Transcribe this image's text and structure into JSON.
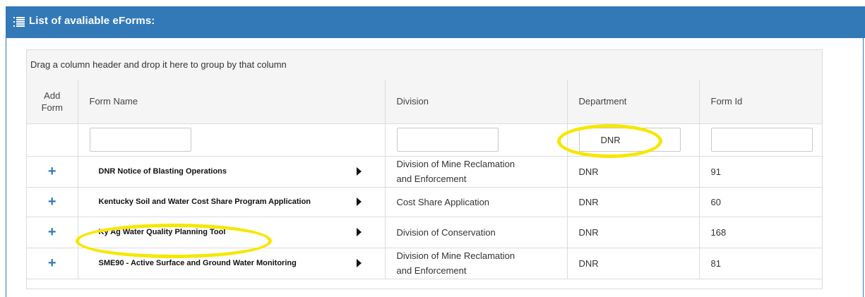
{
  "header": {
    "title": "List of avaliable eForms:",
    "icon": "list-icon"
  },
  "grid": {
    "group_hint": "Drag a column header and drop it here to group by that column",
    "columns": {
      "add_form": [
        "Add",
        "Form"
      ],
      "form_name": "Form Name",
      "division": "Division",
      "department": "Department",
      "form_id": "Form Id"
    },
    "filters": {
      "form_name": "",
      "division": "",
      "department": "DNR",
      "form_id": ""
    },
    "rows": [
      {
        "add": "+",
        "form_name": "DNR Notice of Blasting Operations",
        "division": [
          "Division of Mine Reclamation",
          "and Enforcement"
        ],
        "department": "DNR",
        "form_id": "91"
      },
      {
        "add": "+",
        "form_name": "Kentucky Soil and Water Cost Share Program Application",
        "division": [
          "Cost Share Application"
        ],
        "department": "DNR",
        "form_id": "60"
      },
      {
        "add": "+",
        "form_name": "Ky Ag Water Quality Planning Tool",
        "division": [
          "Division of Conservation"
        ],
        "department": "DNR",
        "form_id": "168"
      },
      {
        "add": "+",
        "form_name": "SME90 - Active Surface and Ground Water Monitoring",
        "division": [
          "Division of Mine Reclamation",
          "and Enforcement"
        ],
        "department": "DNR",
        "form_id": "81"
      }
    ]
  },
  "highlight_color": "#f7e700",
  "accent_color": "#3379b8"
}
